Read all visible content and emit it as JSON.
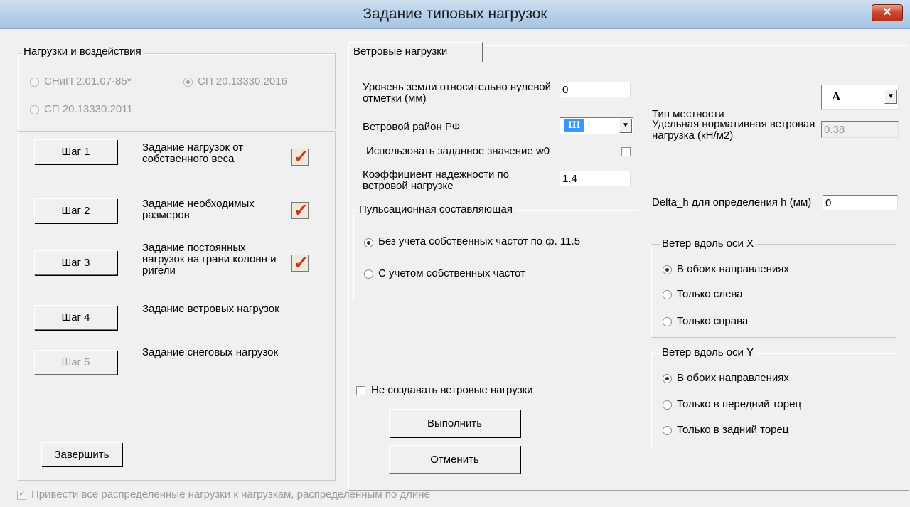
{
  "window": {
    "title": "Задание типовых нагрузок",
    "close_glyph": "✕"
  },
  "loads_group": {
    "title": "Нагрузки и воздействия",
    "options": [
      {
        "label": "СНиП 2.01.07-85*",
        "checked": false
      },
      {
        "label": "СП 20.13330.2016",
        "checked": true
      },
      {
        "label": "СП 20.13330.2011",
        "checked": false
      }
    ]
  },
  "steps": [
    {
      "button": "Шаг 1",
      "desc": "Задание нагрузок от собственного веса",
      "checked": true,
      "enabled": true
    },
    {
      "button": "Шаг 2",
      "desc": "Задание необходимых размеров",
      "checked": true,
      "enabled": true
    },
    {
      "button": "Шаг 3",
      "desc": "Задание постоянных нагрузок на грани колонн и ригели",
      "checked": true,
      "enabled": true
    },
    {
      "button": "Шаг 4",
      "desc": "Задание ветровых нагрузок",
      "checked": false,
      "enabled": true
    },
    {
      "button": "Шаг 5",
      "desc": "Задание снеговых нагрузок",
      "checked": false,
      "enabled": false
    }
  ],
  "finish_button": "Завершить",
  "bottom_option": "Привести все распределенные нагрузки к нагрузкам, распределенным по длине",
  "tab": {
    "label": "Ветровые нагрузки"
  },
  "wind": {
    "ground_level_label": "Уровень земли относительно нулевой отметки (мм)",
    "ground_level_value": "0",
    "region_label": "Ветровой район РФ",
    "region_value": "III",
    "use_w0_label": "Использовать заданное значение w0",
    "reliability_label": "Коэффициент надежности по ветровой нагрузке",
    "reliability_value": "1.4",
    "pulsation": {
      "title": "Пульсационная составляющая",
      "options": [
        {
          "label": "Без учета собственных частот  по ф. 11.5",
          "checked": true
        },
        {
          "label": "С учетом собственных частот",
          "checked": false
        }
      ]
    },
    "terrain_label": "Тип местности",
    "terrain_value": "А",
    "norm_load_label": "Удельная нормативная ветровая нагрузка (кН/м2)",
    "norm_load_value": "0.38",
    "delta_h_label": "Delta_h для определения h (мм)",
    "delta_h_value": "0",
    "wind_x": {
      "title": "Ветер вдоль оси X",
      "options": [
        {
          "label": "В обоих направлениях",
          "checked": true
        },
        {
          "label": "Только слева",
          "checked": false
        },
        {
          "label": "Только справа",
          "checked": false
        }
      ]
    },
    "wind_y": {
      "title": "Ветер вдоль оси Y",
      "options": [
        {
          "label": "В обоих направлениях",
          "checked": true
        },
        {
          "label": "Только в передний торец",
          "checked": false
        },
        {
          "label": "Только в задний торец",
          "checked": false
        }
      ]
    },
    "no_create_label": "Не создавать ветровые нагрузки",
    "run_button": "Выполнить",
    "cancel_button": "Отменить"
  }
}
